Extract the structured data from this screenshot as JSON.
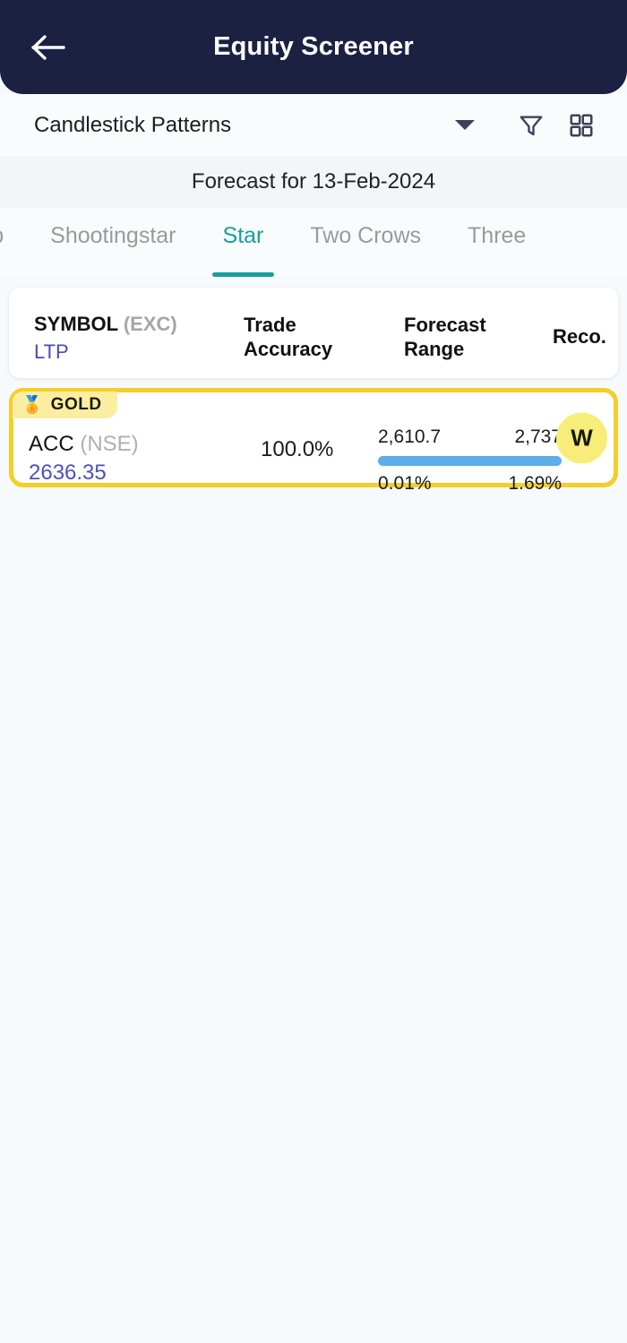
{
  "theme": {
    "appbar_bg": "#1c2142",
    "page_bg": "#f6fafc",
    "accent_teal": "#1a9e9e",
    "gold_border": "#f5ce26",
    "badge_bg": "#fceea0",
    "bar_blue": "#5daee8",
    "ltp_blue": "#4f4fbf",
    "reco_circle_bg": "#f7ed78"
  },
  "appbar": {
    "back_icon": "arrow-left-icon",
    "title": "Equity Screener"
  },
  "selector": {
    "value": "Candlestick Patterns",
    "caret_icon": "chevron-down-icon",
    "filter_icon": "filter-funnel-icon",
    "grid_icon": "grid-view-icon"
  },
  "forecast_band": {
    "text": "Forecast for 13-Feb-2024"
  },
  "tabs": {
    "active_index": 2,
    "items": [
      {
        "label": "rop"
      },
      {
        "label": "Shootingstar"
      },
      {
        "label": "Star"
      },
      {
        "label": "Two Crows"
      },
      {
        "label": "Three"
      }
    ]
  },
  "columns": {
    "symbol_main": "SYMBOL",
    "symbol_exc": " (EXC)",
    "symbol_sub": "LTP",
    "accuracy_l1": "Trade",
    "accuracy_l2": "Accuracy",
    "range_l1": "Forecast",
    "range_l2": "Range",
    "reco": "Reco."
  },
  "rows": [
    {
      "badge_medal": "🏅",
      "badge_label": "GOLD",
      "symbol": "ACC",
      "exchange": " (NSE)",
      "ltp": "2636.35",
      "accuracy": "100.0%",
      "range_low": "2,610.7",
      "range_high": "2,737",
      "pct_low": "0.01%",
      "pct_high": "1.69%",
      "bar_fill_percent": 100,
      "reco": "W"
    }
  ]
}
